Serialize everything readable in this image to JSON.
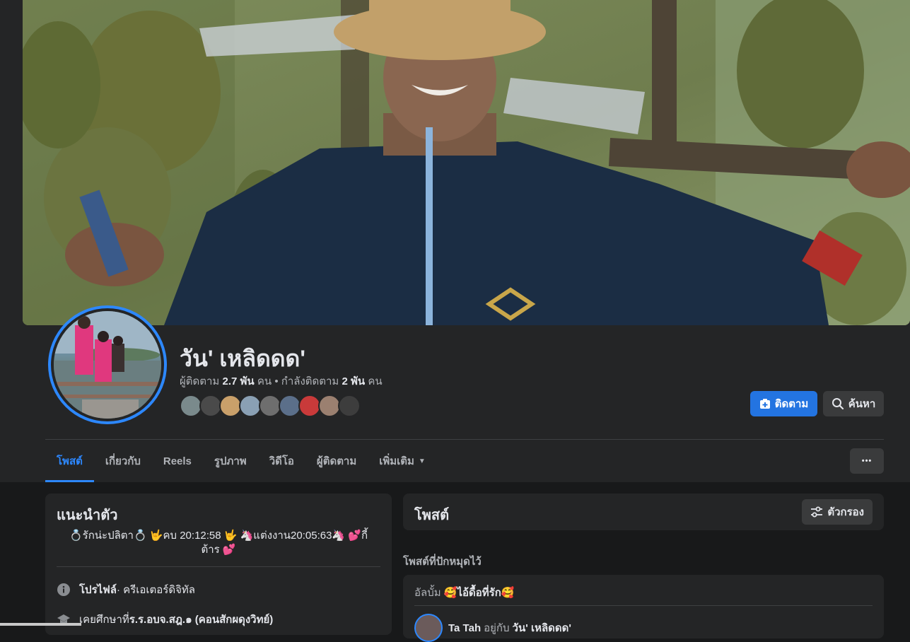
{
  "profile": {
    "name": "วัน' เหลิดดด'",
    "followers_count": "2.7 พัน",
    "followers_label": "ผู้ติดตาม",
    "following_count": "2 พัน",
    "following_label": "กำลังติดตาม",
    "unit": "คน",
    "separator": "•",
    "friend_faces_colors": [
      "#7a8a8c",
      "#4a4a4a",
      "#c9a06a",
      "#8aa0b4",
      "#6e6e6e",
      "#5b6f8a",
      "#c93a3a",
      "#9b8070",
      "#3d3d3d"
    ]
  },
  "actions": {
    "follow_label": "ติดตาม",
    "search_label": "ค้นหา",
    "more_label": "•••"
  },
  "tabs": [
    {
      "label": "โพสต์",
      "active": true
    },
    {
      "label": "เกี่ยวกับ",
      "active": false
    },
    {
      "label": "Reels",
      "active": false
    },
    {
      "label": "รูปภาพ",
      "active": false
    },
    {
      "label": "วิดีโอ",
      "active": false
    },
    {
      "label": "ผู้ติดตาม",
      "active": false
    },
    {
      "label": "เพิ่มเติม",
      "active": false
    }
  ],
  "intro": {
    "title": "แนะนำตัว",
    "bio": "💍รักน่ะปลิตา💍 🤟คบ 20:12:58 🤟 🦄แต่งงาน20:05:63🦄 💕กี้ต้าร 💕",
    "profile_prefix": "โปรไฟล์",
    "profile_suffix": " · ครีเอเตอร์ดิจิทัล",
    "education_prefix": "เคยศึกษาที่ ",
    "education_school": "ร.ร.อบจ.สฎ.๑ (คอนสักผดุงวิทย์)"
  },
  "posts": {
    "title": "โพสต์",
    "filter_label": "ตัวกรอง",
    "pinned_label": "โพสต์ที่ปักหมุดไว้",
    "album_prefix": "อัลบั้ม ",
    "album_name": "🥰ไอ้ดื้อที่รัก🥰",
    "poster_name": "Ta Tah",
    "poster_with": "อยู่กับ",
    "poster_tagged": "วัน' เหลิดดด'"
  },
  "colors": {
    "accent": "#2d88ff",
    "follow_button": "#2374e1",
    "background": "#18191a",
    "card": "#242526"
  }
}
